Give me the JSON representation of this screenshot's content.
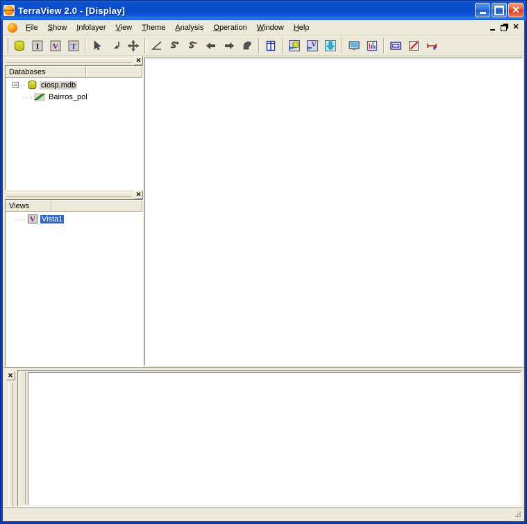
{
  "window": {
    "title": "TerraView 2.0 - [Display]",
    "icon": "terraview-globe-icon",
    "buttons": {
      "minimize": "minimize-button",
      "maximize": "maximize-button",
      "close_glyph": "✕"
    }
  },
  "menu": {
    "icon": "terraview-globe-icon",
    "items": [
      {
        "label": "File",
        "mnemonic": "F"
      },
      {
        "label": "Show",
        "mnemonic": "S"
      },
      {
        "label": "Infolayer",
        "mnemonic": "I"
      },
      {
        "label": "View",
        "mnemonic": "V"
      },
      {
        "label": "Theme",
        "mnemonic": "T"
      },
      {
        "label": "Analysis",
        "mnemonic": "A"
      },
      {
        "label": "Operation",
        "mnemonic": "O"
      },
      {
        "label": "Window",
        "mnemonic": "W"
      },
      {
        "label": "Help",
        "mnemonic": "H"
      }
    ],
    "mdi_buttons": {
      "minimize": "mdi-minimize-button",
      "restore": "mdi-restore-button",
      "close_glyph": "✕"
    }
  },
  "toolbar": {
    "groups": [
      {
        "name": "database-group",
        "buttons": [
          {
            "name": "database-icon",
            "tip": "Database"
          },
          {
            "name": "infolayer-icon",
            "tip": "Infolayer"
          },
          {
            "name": "view-icon",
            "tip": "View"
          },
          {
            "name": "theme-icon",
            "tip": "Theme"
          }
        ]
      },
      {
        "name": "pointer-group",
        "buttons": [
          {
            "name": "pointer-arrow-icon",
            "tip": "Pointer"
          },
          {
            "name": "area-select-icon",
            "tip": "Select area"
          },
          {
            "name": "pan-move-icon",
            "tip": "Pan"
          }
        ]
      },
      {
        "name": "zoom-group",
        "buttons": [
          {
            "name": "measure-distance-icon",
            "tip": "Measure"
          },
          {
            "name": "zoom-in-icon",
            "tip": "Zoom in"
          },
          {
            "name": "zoom-out-icon",
            "tip": "Zoom out"
          },
          {
            "name": "back-arrow-icon",
            "tip": "Previous zoom"
          },
          {
            "name": "forward-arrow-icon",
            "tip": "Next zoom"
          },
          {
            "name": "pan-hand-icon",
            "tip": "Drag"
          }
        ]
      },
      {
        "name": "panel-group",
        "buttons": [
          {
            "name": "split-panel-icon",
            "tip": "Panels"
          }
        ]
      },
      {
        "name": "import-group",
        "buttons": [
          {
            "name": "import-database-icon",
            "tip": "Import database"
          },
          {
            "name": "import-view-icon",
            "tip": "Import view"
          },
          {
            "name": "import-data-icon",
            "tip": "Import data"
          }
        ]
      },
      {
        "name": "display-group",
        "buttons": [
          {
            "name": "display-monitor-icon",
            "tip": "Display window"
          },
          {
            "name": "chart-bars-icon",
            "tip": "Chart"
          }
        ]
      },
      {
        "name": "tools-group",
        "buttons": [
          {
            "name": "table-window-icon",
            "tip": "Table"
          },
          {
            "name": "edit-pencil-icon",
            "tip": "Edit"
          },
          {
            "name": "ruler-scale-icon",
            "tip": "Scale"
          }
        ]
      }
    ]
  },
  "databases_panel": {
    "name": "Databases",
    "close_glyph": "✕",
    "columns": [
      "Databases",
      ""
    ],
    "tree": [
      {
        "label": "ciosp.mdb",
        "icon": "database-cylinder-icon",
        "level": 0,
        "expanded": true,
        "selected": true,
        "selection_style": "gray"
      },
      {
        "label": "Bairros_pol",
        "icon": "polygon-layer-icon",
        "level": 1,
        "expanded": false,
        "selected": false,
        "selection_style": "none"
      }
    ]
  },
  "views_panel": {
    "name": "Views",
    "close_glyph": "✕",
    "columns": [
      "Views",
      ""
    ],
    "tree": [
      {
        "label": "Vista1",
        "icon": "view-v-icon",
        "level": 0,
        "expanded": false,
        "selected": true,
        "selection_style": "blue"
      }
    ]
  },
  "bottom_panel": {
    "name": "grid-panel",
    "close_glyph": "✕"
  },
  "display": {
    "name": "display-canvas",
    "background": "#ffffff"
  },
  "status_bar": {
    "text": ""
  },
  "colors": {
    "titlebar_blue": "#0b4ccb",
    "frame_blue": "#0b3fc4",
    "chrome": "#ece9d8",
    "selection_blue": "#3366cc",
    "selection_gray": "#d8d4c8",
    "layer_green": "#22bb22",
    "database_yellow": "#d8d82e"
  }
}
